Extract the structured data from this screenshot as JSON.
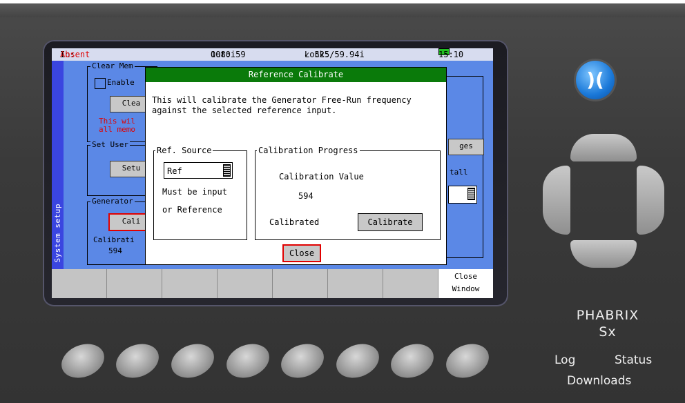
{
  "statusbar": {
    "in_label": "In:",
    "in_value": "Absent",
    "out_label": "Out:",
    "out_value": "1080i59",
    "lock_label": "Lock:",
    "lock_value": "✓ 525/59.94i",
    "time": "15:10"
  },
  "side_tab": {
    "label": "System setup"
  },
  "background_panel": {
    "clear_memory_legend": "Clear Mem",
    "enable_label": "Enable",
    "clear_button": "Clea",
    "warning_line1": "This wil",
    "warning_line2": "all memo",
    "set_user_legend": "Set User",
    "setup_button": "Setu",
    "generator_legend": "Generator",
    "calibrate_button": "Cali",
    "calibration_label": "Calibrati",
    "calibration_value": "594",
    "images_button": "ges",
    "install_label": "tall"
  },
  "softkeys": {
    "close_window_line1": "Close",
    "close_window_line2": "Window"
  },
  "dialog": {
    "title": "Reference Calibrate",
    "message_line1": "This will calibrate the Generator Free-Run frequency",
    "message_line2": "against the selected reference input.",
    "ref_source": {
      "legend": "Ref. Source",
      "selected": "Ref",
      "hint_line1": "Must be input",
      "hint_line2": "or Reference"
    },
    "calibration_progress": {
      "legend": "Calibration Progress",
      "value_label": "Calibration Value",
      "value": "594",
      "status": "Calibrated",
      "calibrate_button": "Calibrate"
    },
    "close_button": "Close"
  },
  "device": {
    "brand_line1": "PHABRIX",
    "brand_line2": "Sx",
    "logo_glyph": ")(",
    "links": {
      "log": "Log",
      "status": "Status",
      "downloads": "Downloads"
    }
  }
}
